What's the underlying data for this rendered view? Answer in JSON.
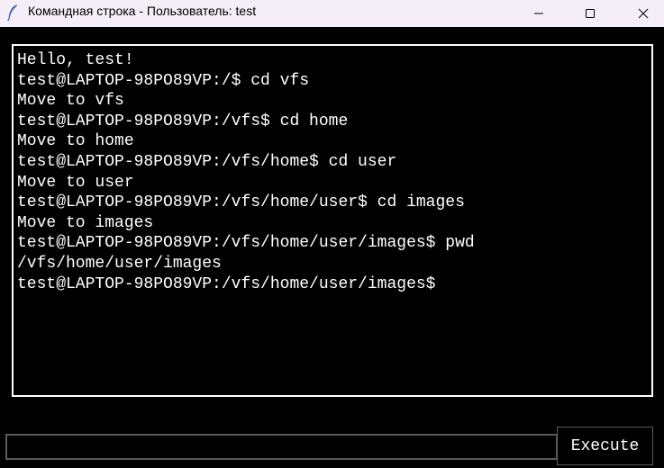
{
  "window": {
    "title": "Командная строка - Пользователь: test",
    "icon": "feather-icon"
  },
  "controls": {
    "minimize_icon": "minimize-icon",
    "maximize_icon": "maximize-icon",
    "close_icon": "close-icon"
  },
  "terminal": {
    "lines": [
      "Hello, test!",
      "test@LAPTOP-98PO89VP:/$ cd vfs",
      "Move to vfs",
      "test@LAPTOP-98PO89VP:/vfs$ cd home",
      "Move to home",
      "test@LAPTOP-98PO89VP:/vfs/home$ cd user",
      "Move to user",
      "test@LAPTOP-98PO89VP:/vfs/home/user$ cd images",
      "Move to images",
      "test@LAPTOP-98PO89VP:/vfs/home/user/images$ pwd",
      "/vfs/home/user/images",
      "test@LAPTOP-98PO89VP:/vfs/home/user/images$"
    ]
  },
  "command": {
    "value": "",
    "execute_label": "Execute"
  },
  "colors": {
    "background": "#000000",
    "text": "#ffffff",
    "titlebar": "#f3eef8",
    "border": "#ffffff"
  }
}
